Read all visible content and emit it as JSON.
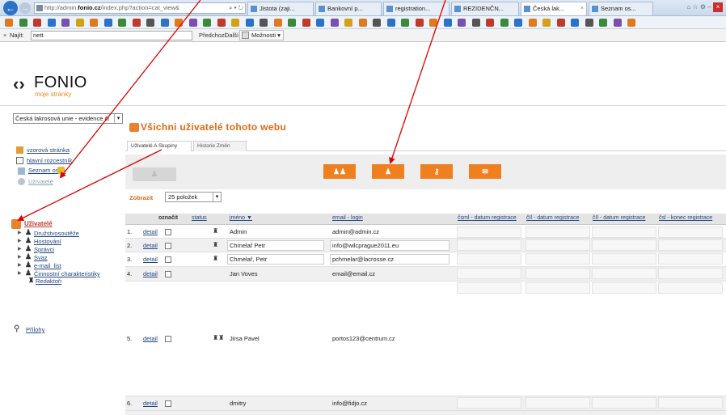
{
  "browser": {
    "address_url_prefix": "http://admin.",
    "address_url_bold": "fonio.cz",
    "address_url_rest": "/index.php?action=cat_view&",
    "address_controls": "⌕ ▾ ↻",
    "tabs": [
      {
        "label": "Jistota (zaji..."
      },
      {
        "label": "Bankovní p..."
      },
      {
        "label": "registration..."
      },
      {
        "label": "REZIDENČN..."
      },
      {
        "label": "Česká lak..."
      },
      {
        "label": "Seznam os..."
      }
    ],
    "active_tab_close": "×",
    "window_controls": "⌂ ☆ ⚙ –",
    "close_label": "×"
  },
  "findbar": {
    "close": "×",
    "label": "Najít:",
    "value": "nett",
    "prev_label": "Předchozí",
    "next_label": "Další",
    "options_label": "Možnosti ▾"
  },
  "logo": {
    "mark": "‹›",
    "name": "FONIO",
    "subtitle": "moje stránky"
  },
  "sidebar": {
    "site_select_value": "Česká lakrosová unie - evidence čl",
    "links": [
      {
        "label": "vzorová stránka"
      },
      {
        "label": "hlavní rozcestník"
      },
      {
        "label": "Seznam osob"
      },
      {
        "label": "Uživatelé"
      }
    ],
    "users_heading": "Uživatelé",
    "users_tree": [
      {
        "label": "Družstvosoutěže"
      },
      {
        "label": "Hostování"
      },
      {
        "label": "Správci"
      },
      {
        "label": "Svaz"
      },
      {
        "label": "e-mail_list"
      },
      {
        "label": "Činnostní charakteristiky"
      },
      {
        "label": "Redaktoři"
      }
    ],
    "attachments": "Přílohy"
  },
  "main": {
    "title": "Všichni uživatelé tohoto webu",
    "tabs": [
      {
        "label": "Uživatelé A Skupiny"
      },
      {
        "label": "Historie Změn"
      }
    ],
    "show_label": "Zobrazit",
    "show_select": "25 položek",
    "action_buttons": [
      {
        "icon": "users-icon",
        "glyph": "♟♟"
      },
      {
        "icon": "user-icon",
        "glyph": "♟"
      },
      {
        "icon": "key-icon",
        "glyph": "⚷"
      },
      {
        "icon": "mail-icon",
        "glyph": "✉"
      }
    ],
    "disabled_button_glyph": "♟"
  },
  "table": {
    "headers": {
      "mark": "označit",
      "status": "status",
      "name": "jméno ▼",
      "email": "email - login",
      "cols": [
        "čsml - datum registrace",
        "čIl - datum registrace",
        "čIl - datum registrace",
        "čsl - konec registrace"
      ]
    },
    "detail_label": "detail",
    "rows": [
      {
        "num": "1.",
        "name": "Admin",
        "email": "admin@admin.cz",
        "status": "♜"
      },
      {
        "num": "2.",
        "name": "Chmelař Petr",
        "email": "info@wilcprague2011.eu",
        "status": "♜"
      },
      {
        "num": "3.",
        "name": "Chmelař, Petr",
        "email": "pchmelar@lacrosse.cz",
        "status": "♜"
      },
      {
        "num": "4.",
        "name": "Jan Voves",
        "email": "email@email.cz",
        "status": ""
      },
      {
        "num": "5.",
        "name": "Jirsa Pavel",
        "email": "portos123@centrum.cz",
        "status": "♜♜"
      },
      {
        "num": "6.",
        "name": "dmitry",
        "email": "info@fidjo.cz",
        "status": ""
      }
    ]
  },
  "colors": {
    "accent_orange": "#f07f1f",
    "title_orange": "#e06a12",
    "link_blue": "#23467f",
    "arrow_red": "#e00000"
  }
}
